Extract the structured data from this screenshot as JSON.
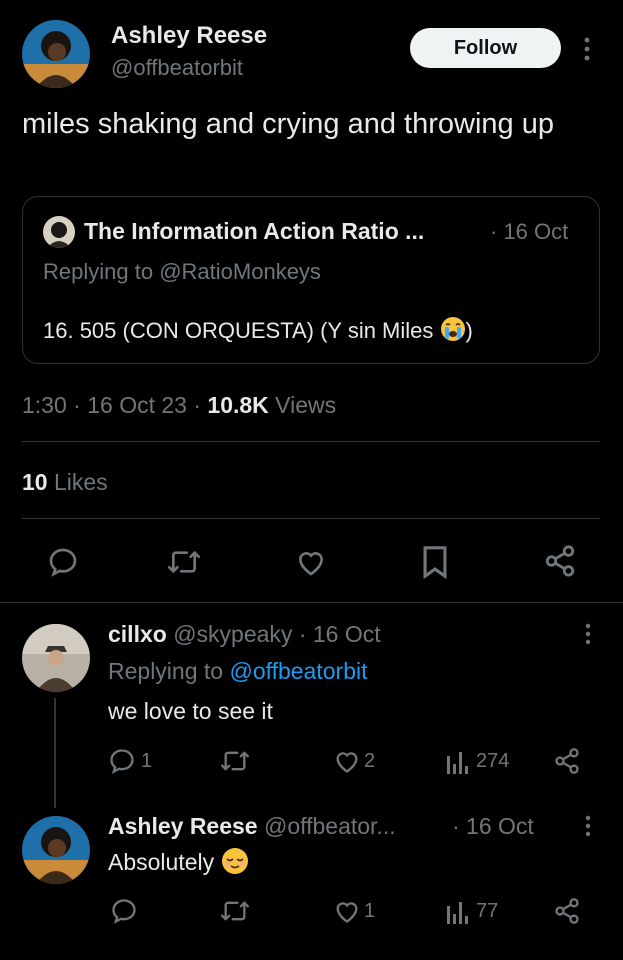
{
  "header": {
    "display_name": "Ashley Reese",
    "handle": "@offbeatorbit",
    "follow_label": "Follow"
  },
  "tweet": {
    "text": "miles shaking and crying and throwing up",
    "time": "1:30",
    "date": "16 Oct 23",
    "views_count": "10.8K",
    "views_label": "Views",
    "likes_count": "10",
    "likes_label": "Likes"
  },
  "quote": {
    "name": "The Information Action Ratio ...",
    "date": "· 16 Oct",
    "replying_prefix": "Replying to",
    "replying_handle": "@RatioMonkeys",
    "text": "16. 505 (CON ORQUESTA) (Y sin Miles",
    "text_end": ")",
    "emoji": "😭"
  },
  "replies": [
    {
      "name": "cillxo",
      "handle": "@skypeaky",
      "date": "· 16 Oct",
      "replying_prefix": "Replying to",
      "replying_handle": "@offbeatorbit",
      "text": "we love to see it",
      "reply_count": "1",
      "like_count": "2",
      "views": "274"
    },
    {
      "name": "Ashley Reese",
      "handle": "@offbeator...",
      "date": "· 16 Oct",
      "text": "Absolutely",
      "emoji": "😌",
      "reply_count": "",
      "like_count": "1",
      "views": "77"
    }
  ],
  "colors": {
    "background": "#000000",
    "text": "#e7e9ea",
    "muted": "#71767b",
    "link": "#1d9bf0",
    "divider": "#2f3336"
  }
}
